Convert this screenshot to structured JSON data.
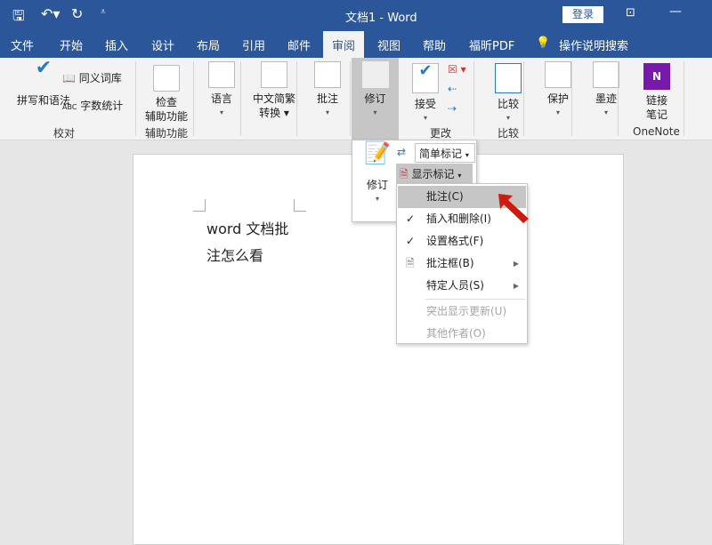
{
  "title": {
    "doc": "文档1  -  Word",
    "login": "登录"
  },
  "tabs": [
    "文件",
    "开始",
    "插入",
    "设计",
    "布局",
    "引用",
    "邮件",
    "审阅",
    "视图",
    "帮助",
    "福昕PDF"
  ],
  "tell_me": "操作说明搜索",
  "ribbon": {
    "spell": "拼写和语法",
    "thesaurus": "同义词库",
    "wordcount": "字数统计",
    "proofing": "校对",
    "access1": "检查",
    "access2": "辅助功能",
    "access_group": "辅助功能",
    "language": "语言",
    "chinese1": "中文简繁",
    "chinese2": "转换",
    "comment": "批注",
    "track": "修订",
    "accept": "接受",
    "changes": "更改",
    "compare": "比较",
    "compare_group": "比较",
    "protect": "保护",
    "ink": "墨迹",
    "link1": "链接",
    "link2": "笔记",
    "onenote": "OneNote"
  },
  "popup": {
    "track": "修订",
    "simple_markup": "简单标记",
    "show_markup": "显示标记"
  },
  "menu": [
    {
      "label": "批注(C)",
      "checked": false,
      "selected": true
    },
    {
      "label": "插入和删除(I)",
      "checked": true
    },
    {
      "label": "设置格式(F)",
      "checked": true
    },
    {
      "label": "批注框(B)",
      "submenu": true
    },
    {
      "label": "特定人员(S)",
      "submenu": true
    },
    {
      "label": "突出显示更新(U)",
      "disabled": true
    },
    {
      "label": "其他作者(O)",
      "disabled": true
    }
  ],
  "doc": {
    "line1": "word 文档批",
    "line2": "注怎么看"
  },
  "check": "✓"
}
